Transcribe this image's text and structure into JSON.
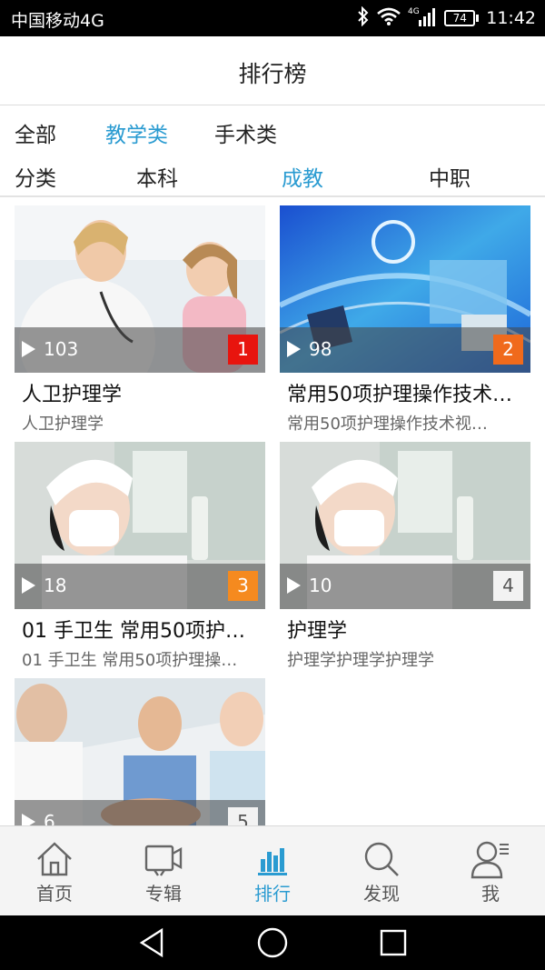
{
  "status_bar": {
    "carrier": "中国移动4G",
    "network": "4G",
    "battery": "74",
    "time": "11:42",
    "icons": [
      "bluetooth-icon",
      "wifi-icon",
      "signal-icon",
      "battery-icon"
    ]
  },
  "header": {
    "title": "排行榜"
  },
  "filters": {
    "row1": [
      {
        "label": "全部",
        "active": false
      },
      {
        "label": "教学类",
        "active": true
      },
      {
        "label": "手术类",
        "active": false
      }
    ],
    "row2": [
      {
        "label": "分类",
        "active": false
      },
      {
        "label": "本科",
        "active": false
      },
      {
        "label": "成教",
        "active": true
      },
      {
        "label": "中职",
        "active": false
      }
    ]
  },
  "courses": [
    {
      "plays": "103",
      "rank": "1",
      "title": "人卫护理学",
      "subtitle": "人卫护理学",
      "rank_color": "#e8140e"
    },
    {
      "plays": "98",
      "rank": "2",
      "title": "常用50项护理操作技术…",
      "subtitle": "常用50项护理操作技术视…",
      "rank_color": "#f06a1c"
    },
    {
      "plays": "18",
      "rank": "3",
      "title": "01 手卫生  常用50项护…",
      "subtitle": "01 手卫生  常用50项护理操…",
      "rank_color": "#f58a1f"
    },
    {
      "plays": "10",
      "rank": "4",
      "title": "护理学",
      "subtitle": "护理学护理学护理学",
      "rank_color": "#f2f2f2"
    },
    {
      "plays": "6",
      "rank": "5",
      "title": "",
      "subtitle": "",
      "rank_color": "#f2f2f2"
    }
  ],
  "tabbar": {
    "items": [
      {
        "label": "首页",
        "icon": "home-icon"
      },
      {
        "label": "专辑",
        "icon": "video-album-icon"
      },
      {
        "label": "排行",
        "icon": "ranking-bars-icon",
        "active": true
      },
      {
        "label": "发现",
        "icon": "search-icon"
      },
      {
        "label": "我",
        "icon": "user-icon"
      }
    ]
  },
  "colors": {
    "accent": "#2a9bd1",
    "rank1": "#e8140e",
    "rank2": "#f06a1c",
    "rank3": "#f58a1f"
  }
}
